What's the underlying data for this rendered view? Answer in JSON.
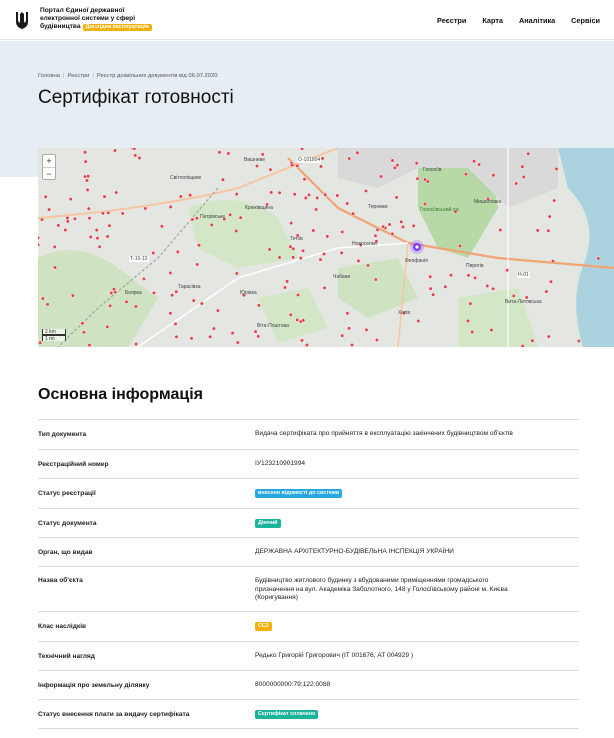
{
  "header": {
    "brand_lines": [
      "Портал Єдиної державної",
      "електронної системи у сфері",
      "будівництва"
    ],
    "beta_badge": "Дослідна експлуатація",
    "nav": [
      "Реєстри",
      "Карта",
      "Аналітика",
      "Сервіси"
    ]
  },
  "breadcrumb": [
    "Головна",
    "Реєстри",
    "Реєстр дозвільних документів від 06.07.2020"
  ],
  "page_title": "Сертифікат готовності",
  "map": {
    "zoom_in": "+",
    "zoom_out": "−",
    "scale": [
      "2 km",
      "1 mi"
    ],
    "labels": [
      "Вишневе",
      "Світлопіщеве",
      "Крюківщина",
      "Петрівське",
      "Тетіїв",
      "Тарасівка",
      "Боярка",
      "Юрівка",
      "Віта-Поштова",
      "Чабани",
      "Новоселки",
      "Феофанія",
      "Хотів",
      "Пирогів",
      "Вита-Литовська",
      "Голосіїв",
      "Мишоловка",
      "Теремки",
      "Голосіївський ліс",
      "О-101804",
      "Т-10-12",
      "Н-01",
      "Кур'янівка"
    ],
    "marker_color": "#7a3cff",
    "point_color": "#e0434c"
  },
  "section_title": "Основна інформація",
  "rows": [
    {
      "label": "Тип документа",
      "value": "Видача сертифіката про прийняття в експлуатацію закінчених будівництвом об'єктів"
    },
    {
      "label": "Реєстраційний номер",
      "value": "ІУ123210901994"
    },
    {
      "label": "Статус реєстрації",
      "tag": "внесено відомості до системи",
      "tag_color": "#29a7df"
    },
    {
      "label": "Статус документа",
      "tag": "Діючий",
      "tag_color": "#1bb39a"
    },
    {
      "label": "Орган, що видав",
      "value": "ДЕРЖАВНА АРХІТЕКТУРНО-БУДІВЕЛЬНА ІНСПЕКЦІЯ УКРАЇНИ"
    },
    {
      "label": "Назва об'єкта",
      "value_lines": [
        "Будівництво житлового будинку з вбудованими приміщеннями громадського",
        "призначення на вул. Академіка Заболотного, 148 у Голосіївському районі м. Києва",
        "(Коригування)"
      ]
    },
    {
      "label": "Клас наслідків",
      "tag": "СС2",
      "tag_color": "#f2b10a"
    },
    {
      "label": "Технічний нагляд",
      "value": "Редько Григорій Григорович (ІТ 001676, АТ 004929 )"
    },
    {
      "label": "Інформація про земельну ділянку",
      "value": "8000000000:79:122:0088"
    },
    {
      "label": "Статус внесення плати за видачу сертифіката",
      "tag": "Сертифікат сплачено",
      "tag_color": "#1bb39a"
    }
  ]
}
